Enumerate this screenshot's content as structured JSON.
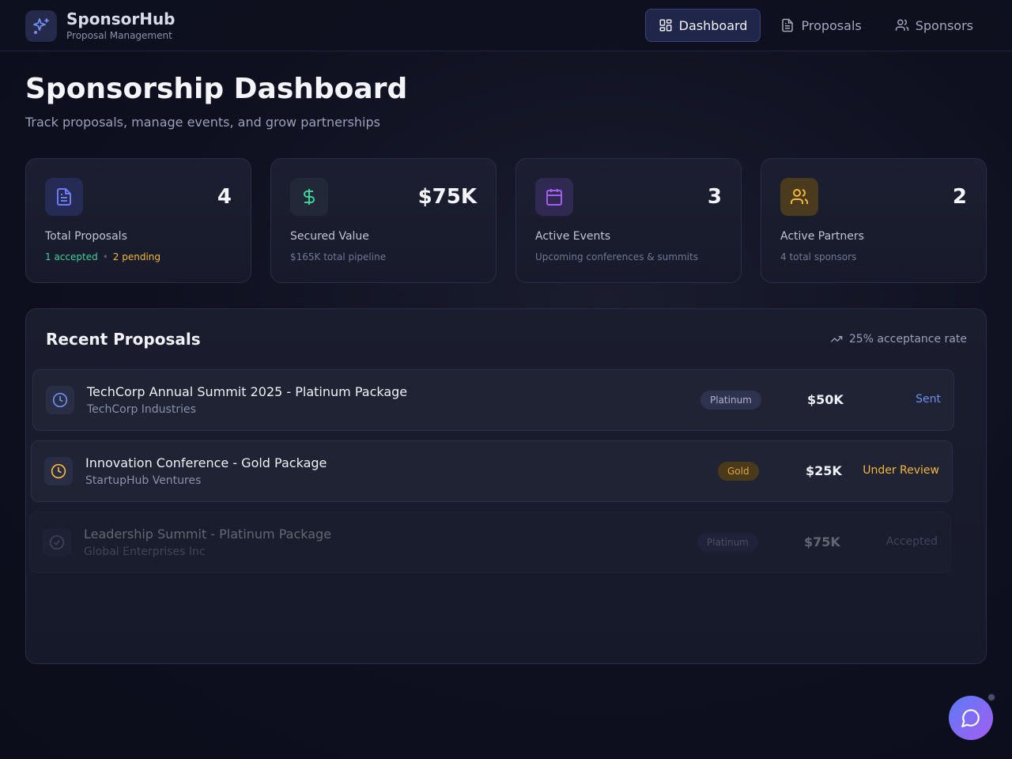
{
  "app": {
    "name": "SponsorHub",
    "subtitle": "Proposal Management"
  },
  "nav": [
    {
      "label": "Dashboard",
      "icon": "grid-icon",
      "active": true
    },
    {
      "label": "Proposals",
      "icon": "document-icon",
      "active": false
    },
    {
      "label": "Sponsors",
      "icon": "users-icon",
      "active": false
    }
  ],
  "page": {
    "title": "Sponsorship Dashboard",
    "subtitle": "Track proposals, manage events, and grow partnerships"
  },
  "stats": [
    {
      "icon": "document-icon",
      "value": "4",
      "label": "Total Proposals",
      "note_accepted": "1 accepted",
      "note_pending": "2 pending",
      "color": "#6f7cf0"
    },
    {
      "icon": "dollar-icon",
      "value": "$75K",
      "label": "Secured Value",
      "note": "$165K total pipeline",
      "color": "#3ed29a"
    },
    {
      "icon": "calendar-icon",
      "value": "3",
      "label": "Active Events",
      "note": "Upcoming conferences & summits",
      "color": "#a45ef2"
    },
    {
      "icon": "users-icon",
      "value": "2",
      "label": "Active Partners",
      "note": "4 total sponsors",
      "color": "#f5b73b"
    }
  ],
  "recent": {
    "title": "Recent Proposals",
    "rate": "25% acceptance rate",
    "rows": [
      {
        "title": "TechCorp Annual Summit 2025 - Platinum Package",
        "org": "TechCorp Industries",
        "tier": "Platinum",
        "amount": "$50K",
        "status": "Sent",
        "icon": "clock-icon"
      },
      {
        "title": "Innovation Conference - Gold Package",
        "org": "StartupHub Ventures",
        "tier": "Gold",
        "amount": "$25K",
        "status": "Under Review",
        "icon": "clock-icon"
      },
      {
        "title": "Leadership Summit - Platinum Package",
        "org": "Global Enterprises Inc",
        "tier": "Platinum",
        "amount": "$75K",
        "status": "Accepted",
        "icon": "check-circle-icon"
      }
    ]
  },
  "chat": {
    "icon": "chat-bubble-icon"
  },
  "colors": {
    "accent": "#5b7bf5",
    "success": "#3ed29a",
    "warning": "#f5b73b",
    "purple": "#a45ef2"
  }
}
